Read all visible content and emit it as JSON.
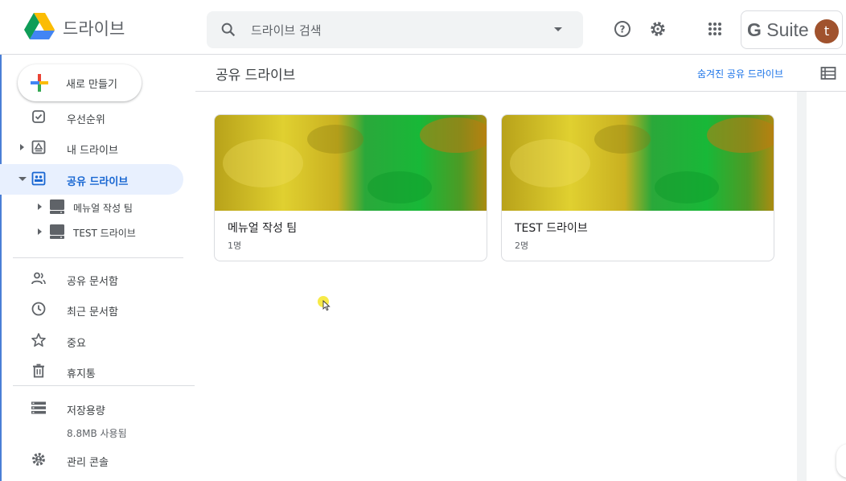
{
  "app": {
    "title": "드라이브"
  },
  "search": {
    "placeholder": "드라이브 검색"
  },
  "header": {
    "brand_g": "G",
    "brand_rest": " Suite",
    "avatar_initial": "t"
  },
  "sidebar": {
    "new_button": "새로 만들기",
    "items": [
      {
        "label": "우선순위",
        "icon": "priority-icon"
      },
      {
        "label": "내 드라이브",
        "icon": "my-drive-icon"
      },
      {
        "label": "공유 드라이브",
        "icon": "shared-drives-icon"
      }
    ],
    "shared_drives": [
      {
        "label": "메뉴얼 작성 팀"
      },
      {
        "label": "TEST 드라이브"
      }
    ],
    "secondary": [
      {
        "label": "공유 문서함",
        "icon": "shared-with-me-icon"
      },
      {
        "label": "최근 문서함",
        "icon": "recent-icon"
      },
      {
        "label": "중요",
        "icon": "star-icon"
      },
      {
        "label": "휴지통",
        "icon": "trash-icon"
      }
    ],
    "storage": {
      "label": "저장용량",
      "used": "8.8MB 사용됨"
    },
    "admin": {
      "label": "관리 콘솔"
    }
  },
  "main": {
    "title": "공유 드라이브",
    "hidden_link": "숨겨진 공유 드라이브",
    "cards": [
      {
        "name": "메뉴얼 작성 팀",
        "members": "1명"
      },
      {
        "name": "TEST 드라이브",
        "members": "2명"
      }
    ]
  },
  "colors": {
    "accent": "#1a73e8",
    "active_bg": "#e8f0fe",
    "avatar": "#a0522d"
  }
}
